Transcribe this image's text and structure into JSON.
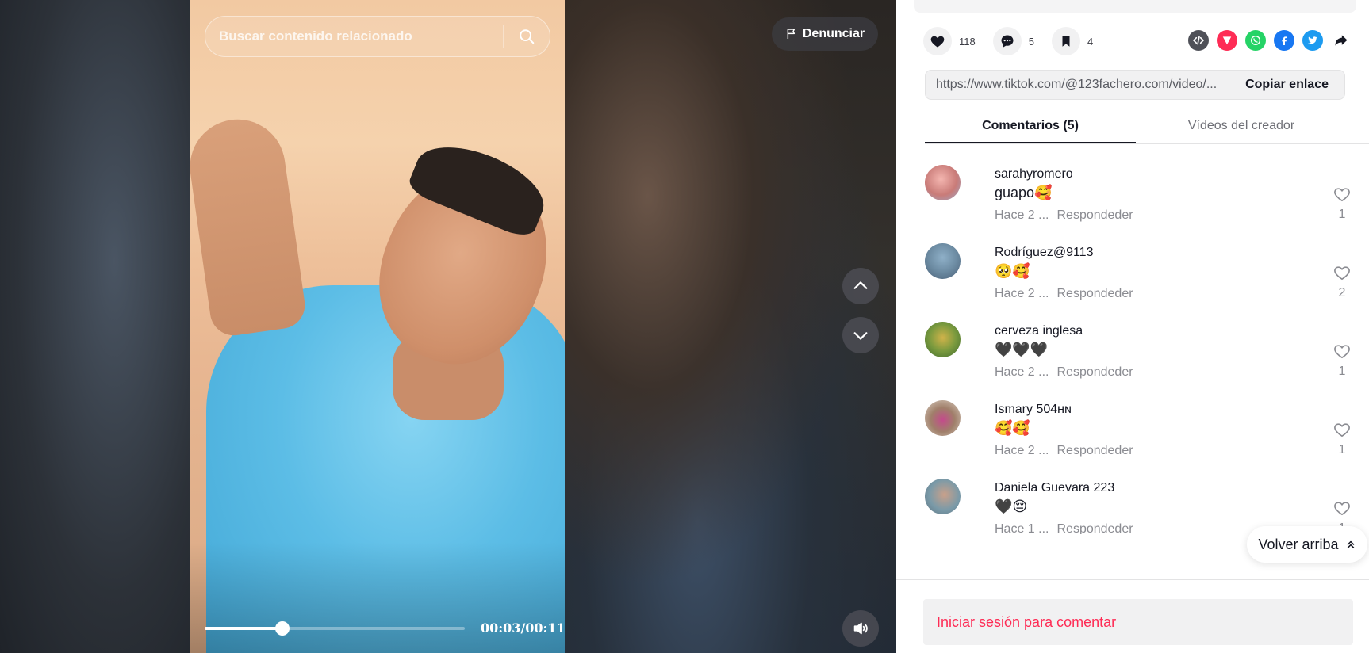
{
  "player": {
    "search_placeholder": "Buscar contenido relacionado",
    "report_label": "Denunciar",
    "time_readout": "00:03/00:11",
    "progress_fraction": 0.3
  },
  "actions": {
    "likes": "118",
    "comments": "5",
    "saves": "4"
  },
  "share": [
    "embed-icon",
    "send-icon",
    "whatsapp-icon",
    "facebook-icon",
    "twitter-icon",
    "share-arrow-icon"
  ],
  "link": {
    "url": "https://www.tiktok.com/@123fachero.com/video/...",
    "copy_label": "Copiar enlace"
  },
  "tabs": [
    {
      "label": "Comentarios (5)",
      "active": true
    },
    {
      "label": "Vídeos del creador",
      "active": false
    }
  ],
  "comments": [
    {
      "user": "sarahyromero",
      "text": "guapo🥰",
      "time": "Hace 2 ...",
      "reply": "Respondeder",
      "likes": "1"
    },
    {
      "user": "Rodríguez@9113",
      "text": "🥺🥰",
      "time": "Hace 2 ...",
      "reply": "Respondeder",
      "likes": "2"
    },
    {
      "user": "cerveza inglesa",
      "text": "🖤🖤🖤",
      "time": "Hace 2 ...",
      "reply": "Respondeder",
      "likes": "1"
    },
    {
      "user": "Ismary 504ʜɴ",
      "text": "🥰🥰",
      "time": "Hace 2 ...",
      "reply": "Respondeder",
      "likes": "1"
    },
    {
      "user": "Daniela Guevara 223",
      "text": "🖤😔",
      "time": "Hace 1 ...",
      "reply": "Respondeder",
      "likes": "1"
    }
  ],
  "back_to_top_label": "Volver arriba",
  "login_prompt": "Iniciar sesión para comentar",
  "colors": {
    "accent": "#fe2c55",
    "facebook": "#1877f2",
    "twitter": "#1d9bf0",
    "whatsapp": "#25d366",
    "send": "#fe2c55",
    "embed": "#4f5158"
  }
}
